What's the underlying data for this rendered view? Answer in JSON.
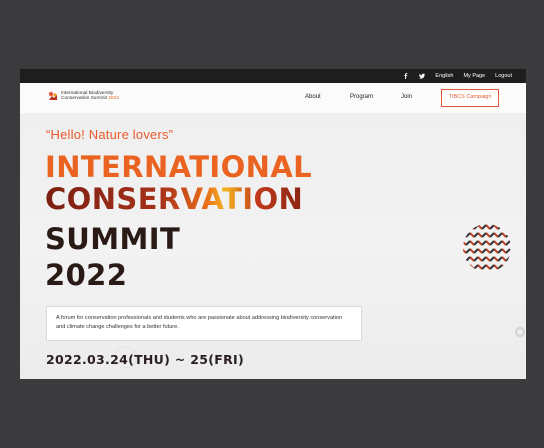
{
  "topbar": {
    "social": [
      "facebook-icon",
      "twitter-icon"
    ],
    "links": [
      "English",
      "My Page",
      "Logout"
    ]
  },
  "logo": {
    "line1": "International Biodiversity",
    "line2": "Conservation Summit",
    "year": "2022"
  },
  "nav": {
    "items": [
      "About",
      "Program",
      "Join"
    ],
    "campaign": "TIBCS Campaign"
  },
  "hero": {
    "tagline": "“Hello! Nature lovers”",
    "title_lines": [
      "INTERNATIONAL",
      "CONSERVATION",
      "SUMMIT",
      "2022"
    ],
    "description": "A forum for conservation professionals and students who are passionate about addressing biodiversity conservation and climate change challenges for a better future.",
    "date": "2022.03.24(THU) ~ 25(FRI)"
  },
  "colors": {
    "accent": "#e85a2c",
    "title_orange": "#ea6320",
    "title_dark": "#2a1a16",
    "topbar": "#1e1e1e",
    "page_bg": "#3b3b3d"
  }
}
